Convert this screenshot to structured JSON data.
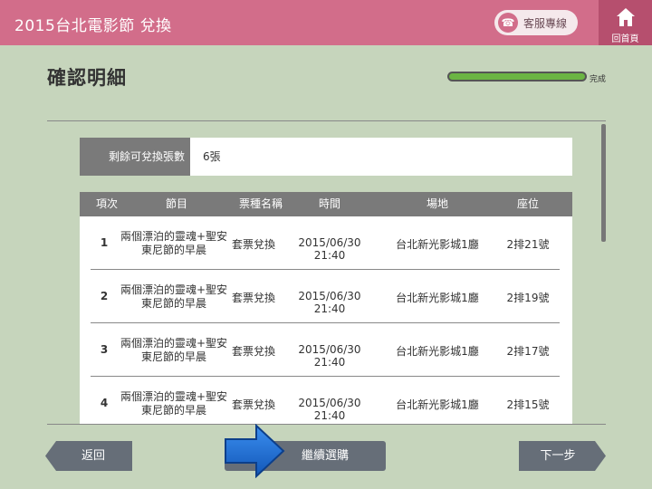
{
  "header": {
    "title": "2015台北電影節 兌換",
    "service_label": "客服專線",
    "home_label": "回首頁"
  },
  "page": {
    "title": "確認明細",
    "progress_label": "完成",
    "progress_fraction": 1.0
  },
  "remaining": {
    "label": "剩餘可兌換張數",
    "value": "6張"
  },
  "table": {
    "headers": [
      "項次",
      "節目",
      "票種名稱",
      "時間",
      "場地",
      "座位"
    ],
    "rows": [
      {
        "num": "1",
        "program": "兩個漂泊的靈魂+聖安東尼節的早晨",
        "ticket": "套票兌換",
        "time": "2015/06/30 21:40",
        "venue": "台北新光影城1廳",
        "seat": "2排21號"
      },
      {
        "num": "2",
        "program": "兩個漂泊的靈魂+聖安東尼節的早晨",
        "ticket": "套票兌換",
        "time": "2015/06/30 21:40",
        "venue": "台北新光影城1廳",
        "seat": "2排19號"
      },
      {
        "num": "3",
        "program": "兩個漂泊的靈魂+聖安東尼節的早晨",
        "ticket": "套票兌換",
        "time": "2015/06/30 21:40",
        "venue": "台北新光影城1廳",
        "seat": "2排17號"
      },
      {
        "num": "4",
        "program": "兩個漂泊的靈魂+聖安東尼節的早晨",
        "ticket": "套票兌換",
        "time": "2015/06/30 21:40",
        "venue": "台北新光影城1廳",
        "seat": "2排15號"
      }
    ]
  },
  "buttons": {
    "back": "返回",
    "continue": "繼續選購",
    "next": "下一步"
  },
  "colors": {
    "header": "#d26d8a",
    "background": "#c6d5bc",
    "progress": "#6bb543",
    "button": "#666e78",
    "arrow": "#1a6fd6"
  },
  "icons": {
    "service": "phone-icon",
    "home": "home-icon",
    "pointer": "arrow-right-icon"
  }
}
